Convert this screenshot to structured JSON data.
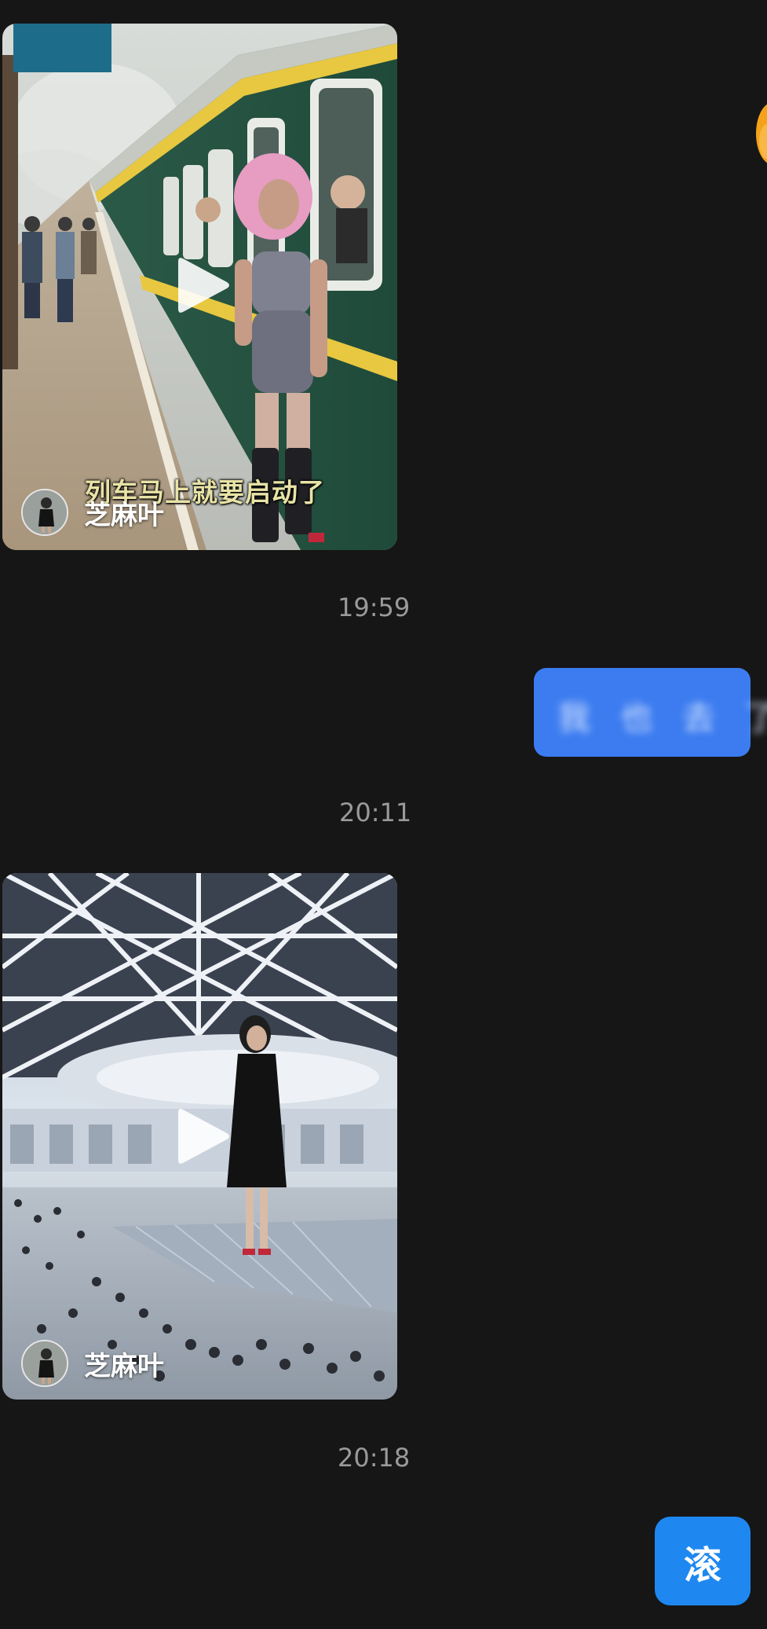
{
  "messages": [
    {
      "type": "video",
      "caption": "列车马上就要启动了",
      "author": "芝麻叶"
    },
    {
      "type": "timestamp",
      "time": "19:59"
    },
    {
      "type": "text_sent_blurred",
      "text": "我 也 去 了"
    },
    {
      "type": "timestamp",
      "time": "20:11"
    },
    {
      "type": "video",
      "author": "芝麻叶"
    },
    {
      "type": "timestamp",
      "time": "20:18"
    },
    {
      "type": "text_sent",
      "text": "滚"
    }
  ],
  "colors": {
    "background": "#161616",
    "sent_bubble": "#3c7cf0",
    "reply_bubble": "#1e88f0",
    "timestamp": "#9a9a9a"
  },
  "icons": [
    "play-icon",
    "avatar",
    "emoji-partial"
  ]
}
